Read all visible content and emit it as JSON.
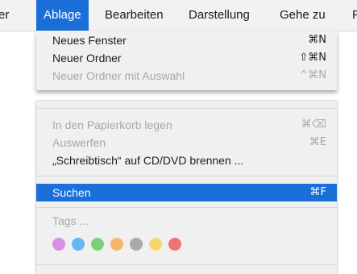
{
  "menubar": {
    "items": [
      {
        "label": "er",
        "active": false
      },
      {
        "label": "Ablage",
        "active": true
      },
      {
        "label": "Bearbeiten",
        "active": false
      },
      {
        "label": "Darstellung",
        "active": false
      },
      {
        "label": "Gehe zu",
        "active": false
      },
      {
        "label": "F",
        "active": false
      }
    ]
  },
  "menu": {
    "top_items": [
      {
        "label": "Neues Fenster",
        "shortcut": "⌘N",
        "enabled": true
      },
      {
        "label": "Neuer Ordner",
        "shortcut": "⇧⌘N",
        "enabled": true
      },
      {
        "label": "Neuer Ordner mit Auswahl",
        "shortcut": "^⌘N",
        "enabled": false
      }
    ],
    "bottom_items": [
      {
        "label": "In den Papierkorb legen",
        "shortcut": "⌘⌫",
        "enabled": false
      },
      {
        "label": "Auswerfen",
        "shortcut": "⌘E",
        "enabled": false
      },
      {
        "label": "„Schreibtisch“ auf CD/DVD brennen ...",
        "shortcut": "",
        "enabled": true
      },
      {
        "label": "Suchen",
        "shortcut": "⌘F",
        "enabled": true,
        "highlighted": true
      }
    ],
    "tags_label": "Tags ...",
    "tag_colors": [
      {
        "name": "purple",
        "color": "#d690e6"
      },
      {
        "name": "blue",
        "color": "#68b5f2"
      },
      {
        "name": "green",
        "color": "#7bd17b"
      },
      {
        "name": "orange",
        "color": "#f3b86b"
      },
      {
        "name": "gray",
        "color": "#a9a9a9"
      },
      {
        "name": "yellow",
        "color": "#f5d76a"
      },
      {
        "name": "red",
        "color": "#ee7575"
      }
    ]
  },
  "colors": {
    "accent": "#1a6fd9",
    "menu_background": "#f0f0f0",
    "disabled_text": "#a8a8a8"
  }
}
